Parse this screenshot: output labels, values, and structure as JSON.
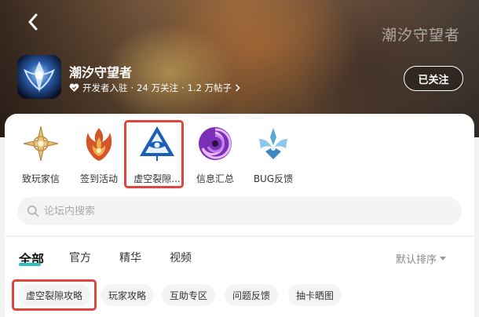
{
  "header": {
    "watermark": "潮汐守望者",
    "game_title": "潮汐守望者",
    "developer_badge": "开发者入驻",
    "followers": "24 万关注",
    "posts": "1.2 万帖子",
    "separator": "·",
    "follow_label": "已关注"
  },
  "shortcuts": [
    {
      "label": "致玩家信",
      "icon": "star-compass-icon"
    },
    {
      "label": "签到活动",
      "icon": "flame-sigil-icon"
    },
    {
      "label": "虚空裂隙...",
      "icon": "void-eye-icon",
      "highlighted": true
    },
    {
      "label": "信息汇总",
      "icon": "purple-vortex-icon"
    },
    {
      "label": "BUG反馈",
      "icon": "ice-crest-icon"
    }
  ],
  "search": {
    "placeholder": "论坛内搜索"
  },
  "tabs": [
    {
      "label": "全部",
      "active": true
    },
    {
      "label": "官方"
    },
    {
      "label": "精华"
    },
    {
      "label": "视频"
    }
  ],
  "sort_label": "默认排序",
  "chips": [
    {
      "label": "虚空裂隙攻略",
      "highlighted": true
    },
    {
      "label": "玩家攻略"
    },
    {
      "label": "互助专区"
    },
    {
      "label": "问题反馈"
    },
    {
      "label": "抽卡晒图"
    }
  ],
  "colors": {
    "accent_teal": "#27c3c0",
    "highlight_red": "#e0443e"
  }
}
